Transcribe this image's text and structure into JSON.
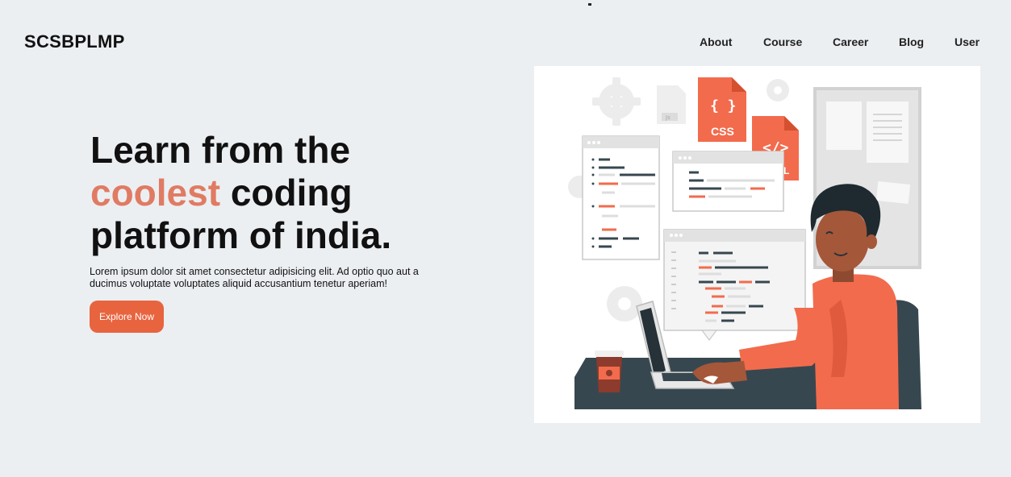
{
  "brand": {
    "name": "SCSBPLMP"
  },
  "nav": {
    "items": [
      "About",
      "Course",
      "Career",
      "Blog",
      "User"
    ]
  },
  "hero": {
    "title_line1": "Learn from the",
    "title_accent": "coolest",
    "title_line2_rest": " coding",
    "title_line3": "platform of india.",
    "description": "Lorem ipsum dolor sit amet consectetur adipisicing elit. Ad optio quo aut a ducimus voluptate voluptates aliquid accusantium tenetur aperiam!",
    "cta_label": "Explore Now"
  },
  "illustration": {
    "css_file_label": "CSS",
    "css_file_glyph": "{ }",
    "html_file_glyph": "</>",
    "html_file_label_partial": "L",
    "js_file_label": "Js"
  },
  "colors": {
    "background": "#eceff2",
    "accent_text": "#e07b63",
    "button": "#e8643f",
    "illustration_orange": "#f26b4d",
    "illustration_dark": "#37474f"
  }
}
